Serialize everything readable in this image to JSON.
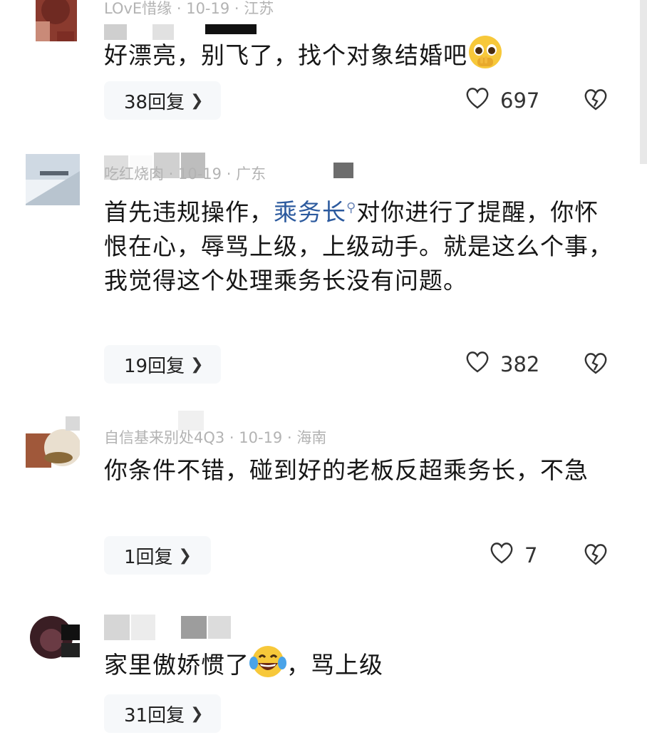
{
  "comments": [
    {
      "meta": "LOvE惜缘 · 10-19 · 江苏",
      "text": "好漂亮，别飞了，找个对象结婚吧",
      "emoji": "pleading-face-icon",
      "reply_label": "38回复",
      "likes": "697"
    },
    {
      "meta": "吃红烧肉 · 10-19 · 广东",
      "text_before": "首先违规操作，",
      "mention": "乘务长",
      "text_after": "对你进行了提醒，你怀恨在心，辱骂上级，上级动手。就是这么个事，我觉得这个处理乘务长没有问题。",
      "reply_label": "19回复",
      "likes": "382"
    },
    {
      "meta": "自信基来别处4Q3 · 10-19 · 海南",
      "text": "你条件不错，碰到好的老板反超乘务长，不急",
      "reply_label": "1回复",
      "likes": "7"
    },
    {
      "meta": "",
      "text_before": "家里傲娇惯了",
      "emoji": "tears-of-joy-icon",
      "text_after": "，骂上级",
      "reply_label": "31回复"
    }
  ],
  "colors": {
    "mention": "#2c5a9e",
    "reply_bg": "#f6f8fa",
    "meta": "#b3b3b3"
  }
}
